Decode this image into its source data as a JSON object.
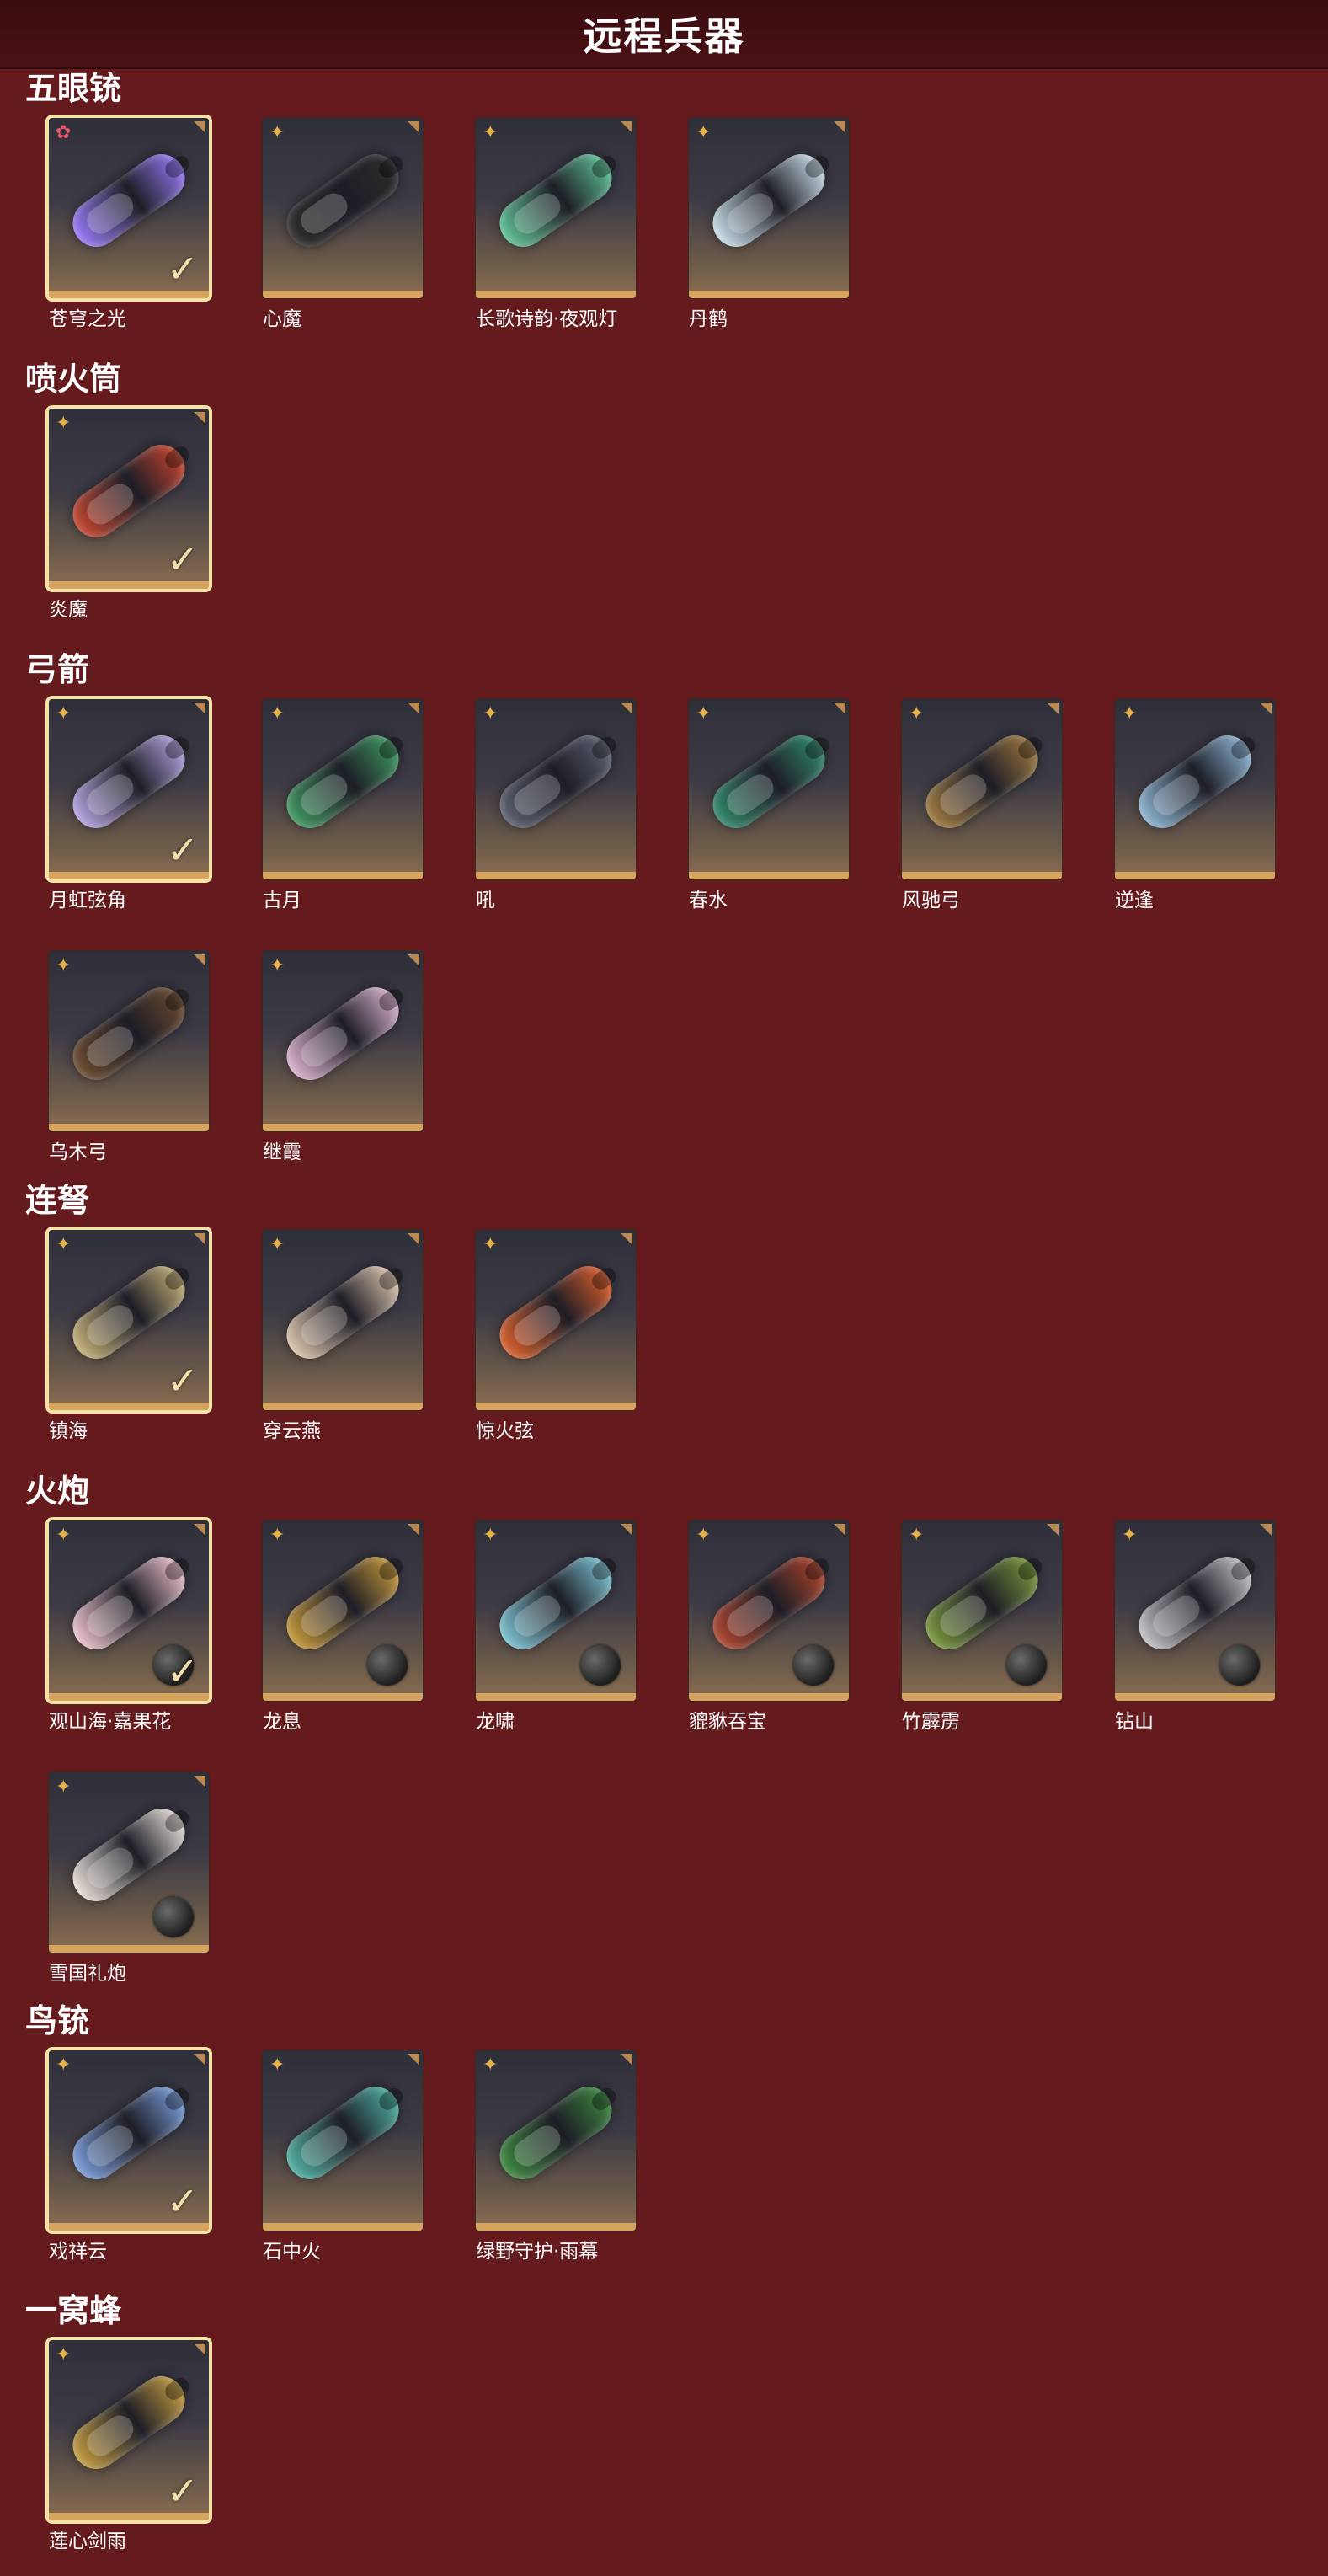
{
  "page": {
    "title": "远程兵器"
  },
  "colors": {
    "background": "#651a1e",
    "title_bar": "#3a0d10",
    "selected_border": "#f6e2a6",
    "card_bottom": "#d6a45e",
    "badge_gold": "#e8b24a",
    "badge_red": "#e0566a"
  },
  "sections": [
    {
      "title": "五眼铳",
      "items": [
        {
          "name": "苍穹之光",
          "selected": true,
          "badge": "red-flower-icon",
          "accent": "#9a7cff"
        },
        {
          "name": "心魔",
          "selected": false,
          "badge": "gold-star-icon",
          "accent": "#2b2b2b"
        },
        {
          "name": "长歌诗韵·夜观灯",
          "selected": false,
          "badge": "gold-star-icon",
          "accent": "#5fc79a"
        },
        {
          "name": "丹鹤",
          "selected": false,
          "badge": "gold-star-icon",
          "accent": "#cfe5f0"
        }
      ]
    },
    {
      "title": "喷火筒",
      "items": [
        {
          "name": "炎魔",
          "selected": true,
          "badge": "gold-star-icon",
          "accent": "#c9452e"
        }
      ]
    },
    {
      "title": "弓箭",
      "items": [
        {
          "name": "月虹弦角",
          "selected": true,
          "badge": "gold-star-icon",
          "accent": "#b8a6e6"
        },
        {
          "name": "古月",
          "selected": false,
          "badge": "gold-star-icon",
          "accent": "#3e9b62"
        },
        {
          "name": "吼",
          "selected": false,
          "badge": "gold-star-icon",
          "accent": "#5b6170"
        },
        {
          "name": "春水",
          "selected": false,
          "badge": "gold-star-icon",
          "accent": "#2f8a6e"
        },
        {
          "name": "风驰弓",
          "selected": false,
          "badge": "gold-star-icon",
          "accent": "#a07a3e"
        },
        {
          "name": "逆逢",
          "selected": false,
          "badge": "gold-star-icon",
          "accent": "#8fb9d8"
        },
        {
          "name": "乌木弓",
          "selected": false,
          "badge": "gold-star-icon",
          "accent": "#6b4a2e"
        },
        {
          "name": "继霞",
          "selected": false,
          "badge": "gold-star-icon",
          "accent": "#e2b6d6"
        }
      ]
    },
    {
      "title": "连弩",
      "items": [
        {
          "name": "镇海",
          "selected": true,
          "badge": "gold-star-icon",
          "accent": "#c9b37a"
        },
        {
          "name": "穿云燕",
          "selected": false,
          "badge": "gold-star-icon",
          "accent": "#e3c9b0"
        },
        {
          "name": "惊火弦",
          "selected": false,
          "badge": "gold-star-icon",
          "accent": "#e0602b"
        }
      ]
    },
    {
      "title": "火炮",
      "items": [
        {
          "name": "观山海·嘉果花",
          "selected": true,
          "badge": "gold-star-icon",
          "accent": "#f2c6d2",
          "ball": true
        },
        {
          "name": "龙息",
          "selected": false,
          "badge": "gold-star-icon",
          "accent": "#c99a3a",
          "ball": true
        },
        {
          "name": "龙啸",
          "selected": false,
          "badge": "gold-star-icon",
          "accent": "#7ec7d8",
          "ball": true
        },
        {
          "name": "貔貅吞宝",
          "selected": false,
          "badge": "gold-star-icon",
          "accent": "#b0442c",
          "ball": true
        },
        {
          "name": "竹霹雳",
          "selected": false,
          "badge": "gold-star-icon",
          "accent": "#7b9a3c",
          "ball": true
        },
        {
          "name": "钻山",
          "selected": false,
          "badge": "gold-star-icon",
          "accent": "#c6c8cc",
          "ball": true
        },
        {
          "name": "雪国礼炮",
          "selected": false,
          "badge": "gold-star-icon",
          "accent": "#efe7e0",
          "ball": true
        }
      ]
    },
    {
      "title": "鸟铳",
      "items": [
        {
          "name": "戏祥云",
          "selected": true,
          "badge": "gold-star-icon",
          "accent": "#7aa0e0"
        },
        {
          "name": "石中火",
          "selected": false,
          "badge": "gold-star-icon",
          "accent": "#4fb4a6"
        },
        {
          "name": "绿野守护·雨幕",
          "selected": false,
          "badge": "gold-star-icon",
          "accent": "#3b8a3f"
        }
      ]
    },
    {
      "title": "一窝蜂",
      "items": [
        {
          "name": "莲心剑雨",
          "selected": true,
          "badge": "gold-star-icon",
          "accent": "#c8a040"
        }
      ]
    }
  ]
}
